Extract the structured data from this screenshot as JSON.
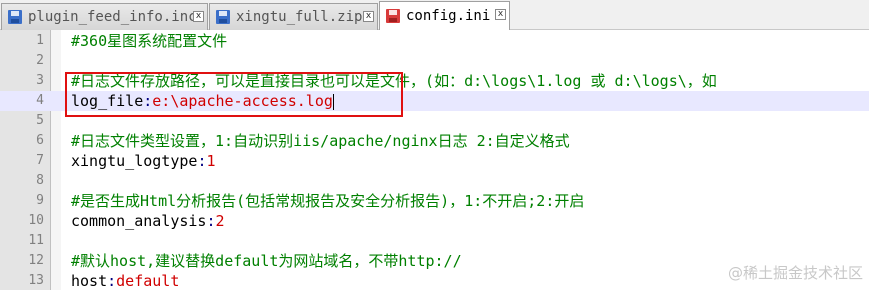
{
  "tabs": [
    {
      "label": "plugin_feed_info.inc",
      "close_glyph": "x",
      "icon": "file-saved-icon",
      "active": false
    },
    {
      "label": "xingtu_full.zip",
      "close_glyph": "x",
      "icon": "file-saved-icon",
      "active": false
    },
    {
      "label": "config.ini",
      "close_glyph": "x",
      "icon": "file-unsaved-icon",
      "active": true
    }
  ],
  "colors": {
    "comment": "#008000",
    "operator": "#000080",
    "value": "#d00000",
    "current_line": "#e8e8ff",
    "highlight_box": "#e01010"
  },
  "lines": [
    {
      "n": "1",
      "comment": "#360星图系统配置文件"
    },
    {
      "n": "2"
    },
    {
      "n": "3",
      "comment": "#日志文件存放路径，可以是直接目录也可以是文件，(如：d:\\logs\\1.log 或 d:\\logs\\，如"
    },
    {
      "n": "4",
      "key": "log_file",
      "op": ":",
      "val": "e:\\apache-access.log",
      "current": true
    },
    {
      "n": "5"
    },
    {
      "n": "6",
      "comment": "#日志文件类型设置，1:自动识别iis/apache/nginx日志 2:自定义格式"
    },
    {
      "n": "7",
      "key": "xingtu_logtype",
      "op": ":",
      "val": "1"
    },
    {
      "n": "8"
    },
    {
      "n": "9",
      "comment": "#是否生成Html分析报告(包括常规报告及安全分析报告)，1:不开启;2:开启"
    },
    {
      "n": "10",
      "key": "common_analysis",
      "op": ":",
      "val": "2"
    },
    {
      "n": "11"
    },
    {
      "n": "12",
      "comment": "#默认host,建议替换default为网站域名，不带http://"
    },
    {
      "n": "13",
      "key": "host",
      "op": ":",
      "val": "default"
    }
  ],
  "watermark": "@稀土掘金技术社区"
}
